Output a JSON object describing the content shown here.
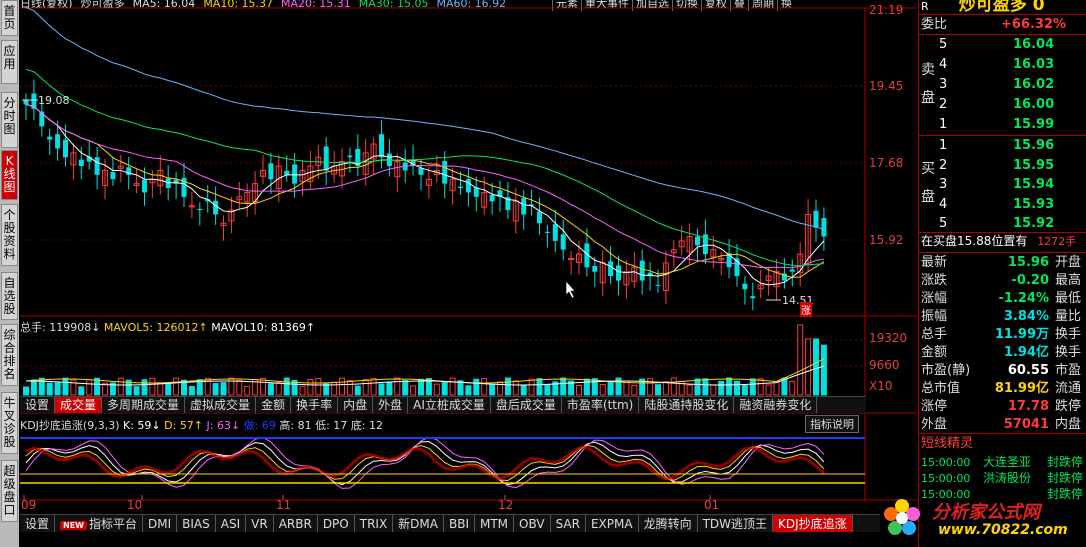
{
  "left_tabs": [
    "首页",
    "应用",
    "分时图",
    "K线图",
    "个股资料",
    "自选股",
    "综合排名",
    "牛叉诊股",
    "超级盘口"
  ],
  "title_row": [
    "日线(复权)",
    "炒可盈多",
    "MA5: 16.04",
    "MA10: 15.37",
    "MA20: 15.31",
    "MA30: 15.05",
    "MA60: 16.92"
  ],
  "top_buttons": [
    "元素",
    "重大事件",
    "加自选",
    "切换",
    "复权",
    "叠",
    "周期",
    "换"
  ],
  "price_ticks": [
    "21.19",
    "19.45",
    "17.68",
    "15.92"
  ],
  "high_label": "19.08",
  "low_label": "14.51",
  "rise_tag": "涨",
  "volume_legend": {
    "a": "总手: 119908↓",
    "b": "MAVOL5: 126012↑",
    "c": "MAVOL10: 81369↑"
  },
  "volume_ticks": [
    "19320",
    "9660",
    "X10"
  ],
  "volume_tabs": [
    "设置",
    "成交量",
    "多周期成交量",
    "虚拟成交量",
    "金额",
    "换手率",
    "内盘",
    "外盘",
    "AI立桩成交量",
    "盘后成交量",
    "市盈率(ttm)",
    "陆股通持股变化",
    "融资融券变化"
  ],
  "kdj_legend": {
    "name": "KDJ抄底追涨(9,3,3)",
    "k": "K: 59↓",
    "d": "D: 57↑",
    "j": "J: 63↓",
    "v": "做: 69",
    "high": "高: 81",
    "low": "低: 17",
    "bottom": "底: 12"
  },
  "kdj_help": "指标说明",
  "x_dates": [
    "09",
    "10",
    "11",
    "12",
    "01"
  ],
  "bottom_tabs": [
    "设置",
    "指标平台",
    "DMI",
    "BIAS",
    "ASI",
    "VR",
    "ARBR",
    "DPO",
    "TRIX",
    "新DMA",
    "BBI",
    "MTM",
    "OBV",
    "SAR",
    "EXPMA",
    "龙腾转向",
    "TDW逃顶王",
    "KDJ抄底追涨"
  ],
  "new_badge": "NEW",
  "right_panel": {
    "header_r": "R",
    "header_name": "炒可盈多 0",
    "weibi_label": "委比",
    "weibi": "+66.32%",
    "sell_label": "卖盘",
    "buy_label": "买盘",
    "sell": [
      [
        "5",
        "16.04"
      ],
      [
        "4",
        "16.03"
      ],
      [
        "3",
        "16.02"
      ],
      [
        "2",
        "16.00"
      ],
      [
        "1",
        "15.99"
      ]
    ],
    "buy": [
      [
        "1",
        "15.96"
      ],
      [
        "2",
        "15.95"
      ],
      [
        "3",
        "15.94"
      ],
      [
        "4",
        "15.93"
      ],
      [
        "5",
        "15.92"
      ]
    ],
    "notice": "在买盘15.88位置有",
    "notice_val": "1272手",
    "stats": [
      [
        "最新",
        "15.96",
        "开盘"
      ],
      [
        "涨跌",
        "-0.20",
        "最高"
      ],
      [
        "涨幅",
        "-1.24%",
        "最低"
      ],
      [
        "振幅",
        "3.84%",
        "量比"
      ],
      [
        "总手",
        "11.99万",
        "换手"
      ],
      [
        "金额",
        "1.94亿",
        "换手"
      ],
      [
        "市盈(静)",
        "60.55",
        "市盈"
      ],
      [
        "总市值",
        "81.99亿",
        "流通"
      ],
      [
        "涨停",
        "17.78",
        "跌停"
      ],
      [
        "外盘",
        "57041",
        "内盘"
      ]
    ],
    "short_title": "短线精灵",
    "short": [
      [
        "15:00:00",
        "大连圣亚",
        "封跌停"
      ],
      [
        "15:00:00",
        "洪涛股份",
        "封跌停"
      ],
      [
        "15:00:00",
        "",
        "封跌停"
      ]
    ]
  },
  "logo_text": "分析家公式网",
  "logo_url": "www.70822.com"
}
